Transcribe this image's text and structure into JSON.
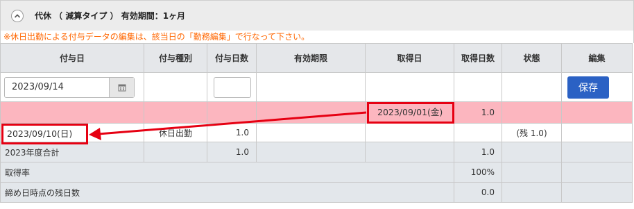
{
  "panel": {
    "title": "代休 （ 減算タイプ ） 有効期間：1ヶ月",
    "notice": "※休日出勤による付与データの編集は、該当日の「勤務編集」で行なって下さい。"
  },
  "columns": [
    "付与日",
    "付与種別",
    "付与日数",
    "有効期限",
    "取得日",
    "取得日数",
    "状態",
    "編集"
  ],
  "input_row": {
    "grant_date_value": "2023/09/14",
    "grant_days_value": "",
    "save_label": "保存"
  },
  "acquired_row": {
    "acquired_date": "2023/09/01(金)",
    "acquired_days": "1.0"
  },
  "grant_row": {
    "grant_date": "2023/09/10(日)",
    "grant_type": "休日出勤",
    "grant_days": "1.0",
    "status": "(残 1.0)"
  },
  "summary": {
    "yearly_label": "2023年度合計",
    "yearly_grant_days": "1.0",
    "yearly_acquired_days": "1.0",
    "rate_label": "取得率",
    "rate_value": "100%",
    "remaining_label": "締め日時点の残日数",
    "remaining_value": "0.0"
  },
  "colors": {
    "highlight_row": "#fcb6bf",
    "annotation_red": "#e60012",
    "save_button": "#2b61c4",
    "notice_text": "#ff6600"
  }
}
